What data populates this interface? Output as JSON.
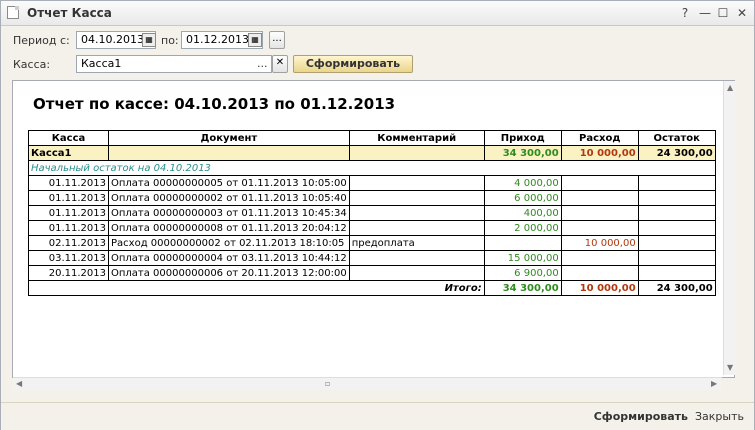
{
  "window": {
    "title": "Отчет  Касса"
  },
  "filter": {
    "period_label": "Период с:",
    "date_from": "04.10.2013",
    "to_label": "по:",
    "date_to": "01.12.2013",
    "ellipsis": "...",
    "kassa_label": "Касса:",
    "kassa_value": "Касса1",
    "kassa_select": "...",
    "kassa_clear": "✕",
    "generate_btn": "Сформировать"
  },
  "report": {
    "title": "Отчет по кассе: 04.10.2013 по 01.12.2013",
    "headers": [
      "Касса",
      "Документ",
      "Комментарий",
      "Приход",
      "Расход",
      "Остаток"
    ],
    "kassa_row": {
      "name": "Касса1",
      "income": "34 300,00",
      "expense": "10 000,00",
      "balance": "24 300,00"
    },
    "opening": "Начальный остаток на 04.10.2013",
    "rows": [
      {
        "date": "01.11.2013",
        "doc": "Оплата 00000000005 от 01.11.2013 10:05:00",
        "comment": "",
        "income": "4 000,00",
        "expense": ""
      },
      {
        "date": "01.11.2013",
        "doc": "Оплата 00000000002 от 01.11.2013 10:05:40",
        "comment": "",
        "income": "6 000,00",
        "expense": ""
      },
      {
        "date": "01.11.2013",
        "doc": "Оплата 00000000003 от 01.11.2013 10:45:34",
        "comment": "",
        "income": "400,00",
        "expense": ""
      },
      {
        "date": "01.11.2013",
        "doc": "Оплата 00000000008 от 01.11.2013 20:04:12",
        "comment": "",
        "income": "2 000,00",
        "expense": ""
      },
      {
        "date": "02.11.2013",
        "doc": "Расход 00000000002 от 02.11.2013 18:10:05",
        "comment": "предоплата",
        "income": "",
        "expense": "10 000,00"
      },
      {
        "date": "03.11.2013",
        "doc": "Оплата 00000000004 от 03.11.2013 10:44:12",
        "comment": "",
        "income": "15 000,00",
        "expense": ""
      },
      {
        "date": "20.11.2013",
        "doc": "Оплата 00000000006 от 20.11.2013 12:00:00",
        "comment": "",
        "income": "6 900,00",
        "expense": ""
      }
    ],
    "total": {
      "label": "Итого:",
      "income": "34 300,00",
      "expense": "10 000,00",
      "balance": "24 300,00"
    }
  },
  "footer": {
    "generate": "Сформировать",
    "close": "Закрыть"
  }
}
